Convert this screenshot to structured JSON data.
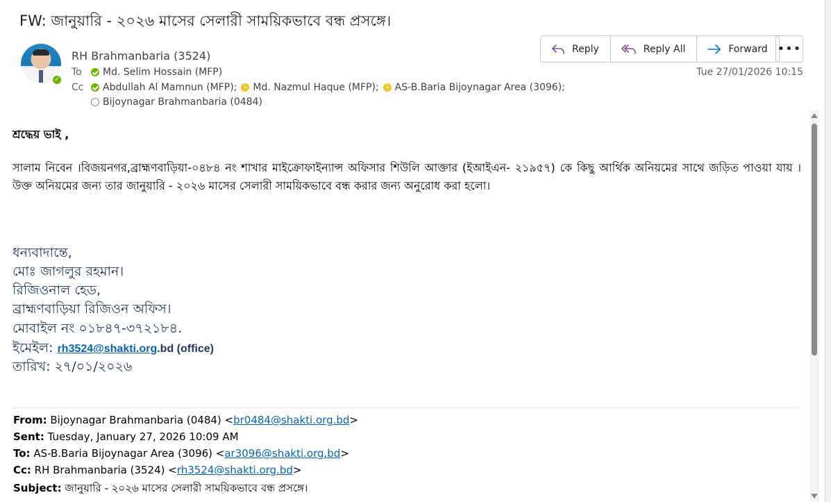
{
  "subject": "FW: জানুয়ারি - ২০২৬ মাসের সেলারী সাময়িকভাবে বন্ধ প্রসঙ্গে।",
  "sender": "RH Brahmanbaria (3524)",
  "to": {
    "label": "To",
    "recipients": [
      {
        "name": "Md. Selim Hossain (MFP)",
        "status": "available"
      }
    ]
  },
  "cc": {
    "label": "Cc",
    "recipients": [
      {
        "name": "Abdullah Al Mamnun (MFP);",
        "status": "available"
      },
      {
        "name": "Md. Nazmul Haque (MFP);",
        "status": "away"
      },
      {
        "name": "AS-B.Baria Bijoynagar Area (3096);",
        "status": "away"
      },
      {
        "name": "Bijoynagar Brahmanbaria (0484)",
        "status": "offline"
      }
    ]
  },
  "actions": {
    "reply": "Reply",
    "reply_all": "Reply All",
    "forward": "Forward",
    "more": "•••"
  },
  "date": "Tue 27/01/2026 10:15",
  "body": {
    "greeting": "শ্রদ্ধেয় ভাই ,",
    "paragraph": "সালাম নিবেন ।বিজয়নগর,ব্রাহ্মণবাড়িয়া-০৪৮৪ নং শাখার মাইক্রোফাইন্যান্স অফিসার শিউলি আক্তার (ইআইএন- ২১৯৫৭) কে কিছু আর্থিক অনিয়মের সাথে জড়িত পাওয়া যায় । উক্ত অনিয়মের জন্য  তার  জানুয়ারি - ২০২৬ মাসের সেলারী সাময়িকভাবে বন্ধ করার জন্য অনুরোধ করা হলো।"
  },
  "signature": {
    "line1": "ধন্যবাদান্তে,",
    "line2": "মোঃ জাগলুর রহমান।",
    "line3": "রিজিওনাল হেড,",
    "line4": "ব্রাহ্মণবাড়িয়া রিজিওন অফিস।",
    "line5": "মোবাইল নং ০১৮৪৭-৩৭২১৮৪.",
    "email_label": "ইমেইল: ",
    "email_link": "rh3524@shakti.org",
    "email_suffix": ".bd (office)",
    "date_label": "তারিখ:  ",
    "date_value": "২৭/০১/২০২৬"
  },
  "forwarded": {
    "from_label": "From:",
    "from_value": " Bijoynagar Brahmanbaria (0484) <",
    "from_email": "br0484@shakti.org.bd",
    "sent_label": "Sent:",
    "sent_value": " Tuesday, January 27, 2026 10:09 AM",
    "to_label": "To:",
    "to_value": " AS-B.Baria Bijoynagar Area (3096) <",
    "to_email": "ar3096@shakti.org.bd",
    "cc_label": "Cc:",
    "cc_value": " RH Brahmanbaria (3524) <",
    "cc_email": "rh3524@shakti.org.bd",
    "subject_label": "Subject:",
    "subject_value": " জানুয়ারি - ২০২৬ মাসের সেলারী সাময়িকভাবে বন্ধ প্রসঙ্গে।",
    "close": ">"
  },
  "colors": {
    "accent": "#0f6cbd",
    "presence_available": "#6bb700",
    "presence_away": "#f8c31d",
    "signature": "#1f3864",
    "link": "#0563c1"
  }
}
